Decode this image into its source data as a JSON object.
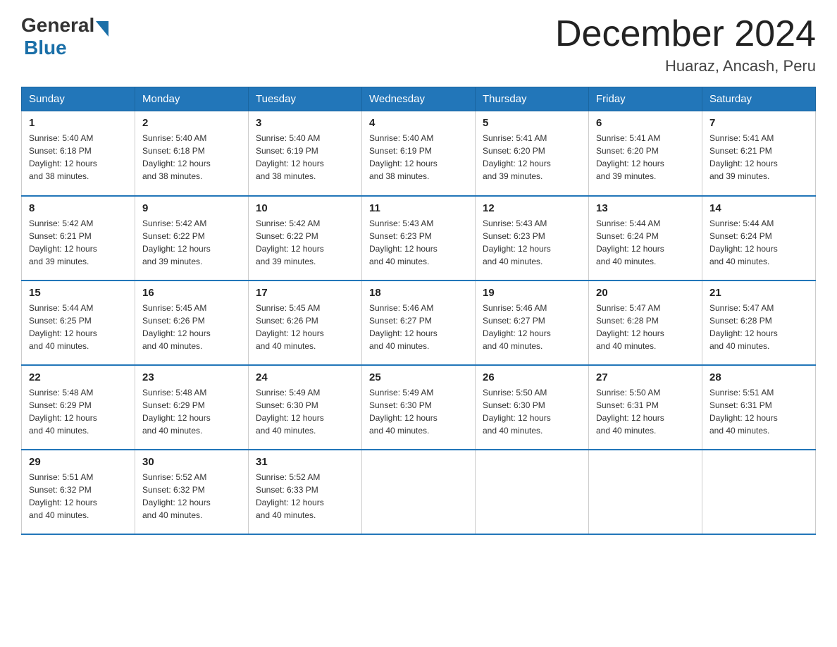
{
  "logo": {
    "general": "General",
    "blue": "Blue"
  },
  "title": "December 2024",
  "subtitle": "Huaraz, Ancash, Peru",
  "days_of_week": [
    "Sunday",
    "Monday",
    "Tuesday",
    "Wednesday",
    "Thursday",
    "Friday",
    "Saturday"
  ],
  "weeks": [
    [
      {
        "date": "1",
        "sunrise": "5:40 AM",
        "sunset": "6:18 PM",
        "daylight": "12 hours and 38 minutes."
      },
      {
        "date": "2",
        "sunrise": "5:40 AM",
        "sunset": "6:18 PM",
        "daylight": "12 hours and 38 minutes."
      },
      {
        "date": "3",
        "sunrise": "5:40 AM",
        "sunset": "6:19 PM",
        "daylight": "12 hours and 38 minutes."
      },
      {
        "date": "4",
        "sunrise": "5:40 AM",
        "sunset": "6:19 PM",
        "daylight": "12 hours and 38 minutes."
      },
      {
        "date": "5",
        "sunrise": "5:41 AM",
        "sunset": "6:20 PM",
        "daylight": "12 hours and 39 minutes."
      },
      {
        "date": "6",
        "sunrise": "5:41 AM",
        "sunset": "6:20 PM",
        "daylight": "12 hours and 39 minutes."
      },
      {
        "date": "7",
        "sunrise": "5:41 AM",
        "sunset": "6:21 PM",
        "daylight": "12 hours and 39 minutes."
      }
    ],
    [
      {
        "date": "8",
        "sunrise": "5:42 AM",
        "sunset": "6:21 PM",
        "daylight": "12 hours and 39 minutes."
      },
      {
        "date": "9",
        "sunrise": "5:42 AM",
        "sunset": "6:22 PM",
        "daylight": "12 hours and 39 minutes."
      },
      {
        "date": "10",
        "sunrise": "5:42 AM",
        "sunset": "6:22 PM",
        "daylight": "12 hours and 39 minutes."
      },
      {
        "date": "11",
        "sunrise": "5:43 AM",
        "sunset": "6:23 PM",
        "daylight": "12 hours and 40 minutes."
      },
      {
        "date": "12",
        "sunrise": "5:43 AM",
        "sunset": "6:23 PM",
        "daylight": "12 hours and 40 minutes."
      },
      {
        "date": "13",
        "sunrise": "5:44 AM",
        "sunset": "6:24 PM",
        "daylight": "12 hours and 40 minutes."
      },
      {
        "date": "14",
        "sunrise": "5:44 AM",
        "sunset": "6:24 PM",
        "daylight": "12 hours and 40 minutes."
      }
    ],
    [
      {
        "date": "15",
        "sunrise": "5:44 AM",
        "sunset": "6:25 PM",
        "daylight": "12 hours and 40 minutes."
      },
      {
        "date": "16",
        "sunrise": "5:45 AM",
        "sunset": "6:26 PM",
        "daylight": "12 hours and 40 minutes."
      },
      {
        "date": "17",
        "sunrise": "5:45 AM",
        "sunset": "6:26 PM",
        "daylight": "12 hours and 40 minutes."
      },
      {
        "date": "18",
        "sunrise": "5:46 AM",
        "sunset": "6:27 PM",
        "daylight": "12 hours and 40 minutes."
      },
      {
        "date": "19",
        "sunrise": "5:46 AM",
        "sunset": "6:27 PM",
        "daylight": "12 hours and 40 minutes."
      },
      {
        "date": "20",
        "sunrise": "5:47 AM",
        "sunset": "6:28 PM",
        "daylight": "12 hours and 40 minutes."
      },
      {
        "date": "21",
        "sunrise": "5:47 AM",
        "sunset": "6:28 PM",
        "daylight": "12 hours and 40 minutes."
      }
    ],
    [
      {
        "date": "22",
        "sunrise": "5:48 AM",
        "sunset": "6:29 PM",
        "daylight": "12 hours and 40 minutes."
      },
      {
        "date": "23",
        "sunrise": "5:48 AM",
        "sunset": "6:29 PM",
        "daylight": "12 hours and 40 minutes."
      },
      {
        "date": "24",
        "sunrise": "5:49 AM",
        "sunset": "6:30 PM",
        "daylight": "12 hours and 40 minutes."
      },
      {
        "date": "25",
        "sunrise": "5:49 AM",
        "sunset": "6:30 PM",
        "daylight": "12 hours and 40 minutes."
      },
      {
        "date": "26",
        "sunrise": "5:50 AM",
        "sunset": "6:30 PM",
        "daylight": "12 hours and 40 minutes."
      },
      {
        "date": "27",
        "sunrise": "5:50 AM",
        "sunset": "6:31 PM",
        "daylight": "12 hours and 40 minutes."
      },
      {
        "date": "28",
        "sunrise": "5:51 AM",
        "sunset": "6:31 PM",
        "daylight": "12 hours and 40 minutes."
      }
    ],
    [
      {
        "date": "29",
        "sunrise": "5:51 AM",
        "sunset": "6:32 PM",
        "daylight": "12 hours and 40 minutes."
      },
      {
        "date": "30",
        "sunrise": "5:52 AM",
        "sunset": "6:32 PM",
        "daylight": "12 hours and 40 minutes."
      },
      {
        "date": "31",
        "sunrise": "5:52 AM",
        "sunset": "6:33 PM",
        "daylight": "12 hours and 40 minutes."
      },
      null,
      null,
      null,
      null
    ]
  ],
  "labels": {
    "sunrise": "Sunrise:",
    "sunset": "Sunset:",
    "daylight": "Daylight:"
  }
}
